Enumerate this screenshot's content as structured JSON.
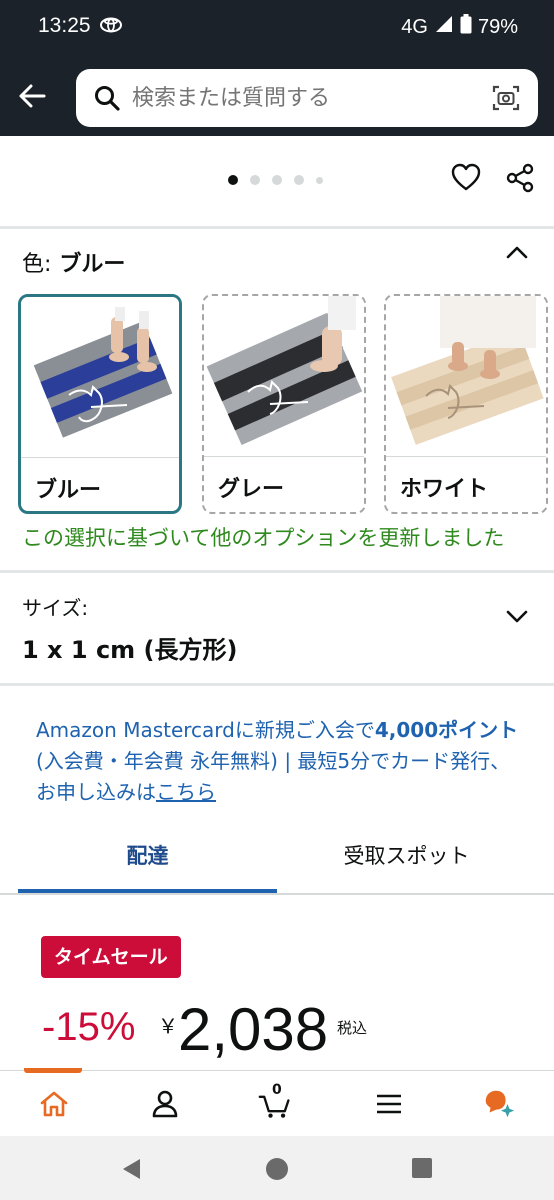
{
  "status": {
    "time": "13:25",
    "network": "4G",
    "battery": "79%"
  },
  "search": {
    "placeholder": "検索または質問する"
  },
  "carousel": {
    "dot_count": 5,
    "active_index": 0
  },
  "color": {
    "label": "色:",
    "selected": "ブルー",
    "options": [
      {
        "name": "ブルー",
        "selected": true
      },
      {
        "name": "グレー",
        "selected": false
      },
      {
        "name": "ホワイト",
        "selected": false
      }
    ],
    "update_note": "この選択に基づいて他のオプションを更新しました"
  },
  "size": {
    "label": "サイズ:",
    "value": "1 x 1 cm (長方形)"
  },
  "promo": {
    "part1": "Amazon Mastercardに新規ご入会で",
    "points": "4,000ポイント",
    "part2": " (入会費・年会費 永年無料) | 最短5分でカード発行、お申し込みは",
    "link": "こちら"
  },
  "tabs": {
    "delivery": "配達",
    "pickup": "受取スポット"
  },
  "price": {
    "badge": "タイムセール",
    "discount": "-15%",
    "currency": "￥",
    "amount": "2,038",
    "tax_note": "税込"
  },
  "bottom_nav": {
    "cart_count": "0"
  },
  "colors": {
    "header_bg": "#1b222a",
    "accent_teal": "#2c7784",
    "link_blue": "#1f63b0",
    "deal_red": "#cc0c39",
    "success_green": "#2f8a1e",
    "home_orange": "#e76a23"
  }
}
